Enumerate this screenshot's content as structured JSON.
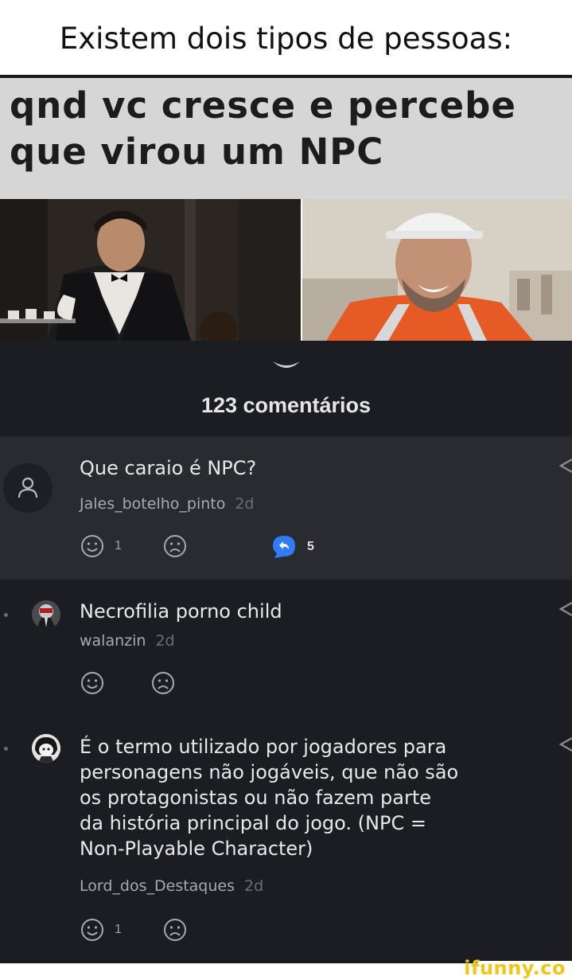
{
  "caption": "Existem dois tipos de pessoas:",
  "meme": {
    "line1": "qnd vc cresce e percebe",
    "line2": "que virou um NPC"
  },
  "comments_header": {
    "count_label": "123 comentários"
  },
  "comments": [
    {
      "text": "Que caraio é NPC?",
      "user": "Jales_botelho_pinto",
      "age": "2d",
      "smile_count": "1",
      "replies": "5"
    },
    {
      "text": "Necrofilia porno child",
      "user": "walanzin",
      "age": "2d"
    },
    {
      "text_lines": [
        "É o termo utilizado por jogadores para",
        "personagens não jogáveis, que não são",
        "os protagonistas ou não fazem parte",
        "da história principal do jogo. (NPC =",
        "Non-Playable Character)"
      ],
      "user": "Lord_dos_Destaques",
      "age": "2d",
      "smile_count": "1"
    }
  ],
  "watermark": "ifunny.co",
  "colors": {
    "accent_blue": "#2f7cf6",
    "watermark_yellow": "#f2c617",
    "app_background": "#1c1d22"
  }
}
